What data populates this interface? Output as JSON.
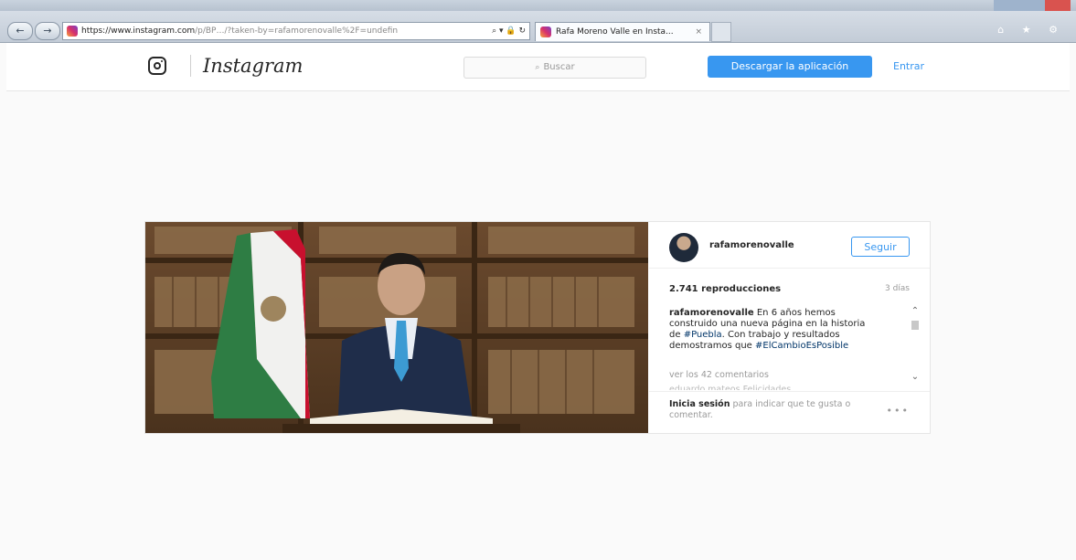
{
  "browser": {
    "url_host": "https://www.instagram.com",
    "url_path": "/p/BP…/?taken-by=rafamorenovalle%2F=undefin",
    "url_icons": "⌕ ▾ 🔒 ↻",
    "tab_label": "Rafa Moreno Valle en Insta...",
    "tab_close": "×",
    "back": "←",
    "forward": "→",
    "right_icons": "⌂ ★ ⚙"
  },
  "header": {
    "logo_text": "Instagram",
    "search_placeholder": "Buscar",
    "search_icon": "⌕",
    "download_label": "Descargar la aplicación",
    "login_label": "Entrar"
  },
  "post": {
    "username": "rafamorenovalle",
    "follow_label": "Seguir",
    "views": "2.741 reproducciones",
    "time": "3 días",
    "caption_user": "rafamorenovalle",
    "caption_text_1": " En 6 años hemos construido una nueva página en la historia de ",
    "caption_tag_1": "#Puebla",
    "caption_text_2": ". Con trabajo y resultados demostramos que ",
    "caption_tag_2": "#ElCambioEsPosible",
    "comments_link": "ver los 42 comentarios",
    "cutoff_comment": "eduardo.mateos Felicidades",
    "footer_link": "Inicia sesión",
    "footer_text": " para indicar que te gusta o comentar.",
    "more_label": "•••",
    "scroll_up": "⌃",
    "scroll_down": "⌄"
  },
  "colors": {
    "accent": "#3897f0",
    "background": "#fafafa"
  },
  "icons": [
    "instagram-camera-icon",
    "search-icon",
    "more-options-icon",
    "scroll-up-icon",
    "scroll-down-icon",
    "instagram-favicon-icon"
  ]
}
